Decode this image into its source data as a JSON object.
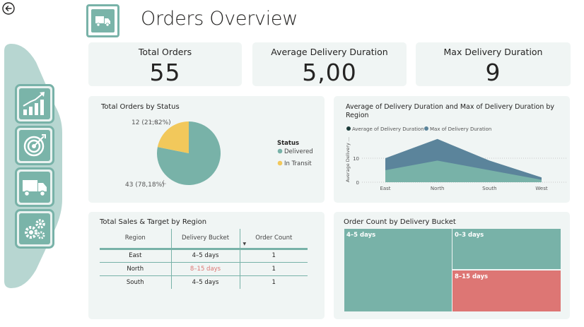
{
  "page": {
    "title": "Orders Overview"
  },
  "colors": {
    "teal": "#78b2a8",
    "blue_gray": "#5b849b",
    "yellow": "#f2c85b",
    "red": "#dd7674",
    "dark": "#252423"
  },
  "nav": {
    "back_icon": "back-arrow-icon",
    "items": [
      {
        "name": "analytics",
        "icon": "growth-chart-icon"
      },
      {
        "name": "targets",
        "icon": "target-icon"
      },
      {
        "name": "orders",
        "icon": "delivery-truck-icon"
      },
      {
        "name": "settings",
        "icon": "gears-icon"
      }
    ]
  },
  "kpis": [
    {
      "label": "Total Orders",
      "value": "55"
    },
    {
      "label": "Average Delivery Duration",
      "value": "5,00"
    },
    {
      "label": "Max Delivery Duration",
      "value": "9"
    }
  ],
  "status_chart": {
    "title": "Total Orders by Status",
    "legend_title": "Status",
    "slices": [
      {
        "name": "Delivered",
        "value": 43,
        "label": "43 (78,18%)"
      },
      {
        "name": "In Transit",
        "value": 12,
        "label": "12 (21,82%)"
      }
    ]
  },
  "duration_chart": {
    "title_line1": "Average of Delivery Duration and Max of Delivery Duration by",
    "title_line2": "Region",
    "legend": [
      "Average of Delivery Duration",
      "Max of Delivery Duration"
    ],
    "ylabel": "Average Delivery ...",
    "yticks": [
      "0",
      "10"
    ]
  },
  "chart_data": {
    "type": "area",
    "categories": [
      "East",
      "North",
      "South",
      "West"
    ],
    "series": [
      {
        "name": "Average of Delivery Duration",
        "values": [
          5,
          9,
          5,
          1
        ]
      },
      {
        "name": "Max of Delivery Duration",
        "values": [
          10,
          18,
          9,
          2
        ]
      }
    ],
    "ylim": [
      0,
      20
    ]
  },
  "sales_table": {
    "title": "Total Sales & Target by Region",
    "columns": [
      "Region",
      "Delivery Bucket",
      "Order Count"
    ],
    "sort_icon": "sort-desc-icon",
    "rows": [
      {
        "region": "East",
        "bucket": "4–5 days",
        "count": "1"
      },
      {
        "region": "North",
        "bucket": "8–15 days",
        "count": "1"
      },
      {
        "region": "South",
        "bucket": "4–5 days",
        "count": "1"
      }
    ]
  },
  "treemap": {
    "title": "Order Count by Delivery Bucket",
    "tiles": [
      {
        "label": "4–5 days"
      },
      {
        "label": "0–3 days"
      },
      {
        "label": "8–15 days"
      }
    ]
  }
}
